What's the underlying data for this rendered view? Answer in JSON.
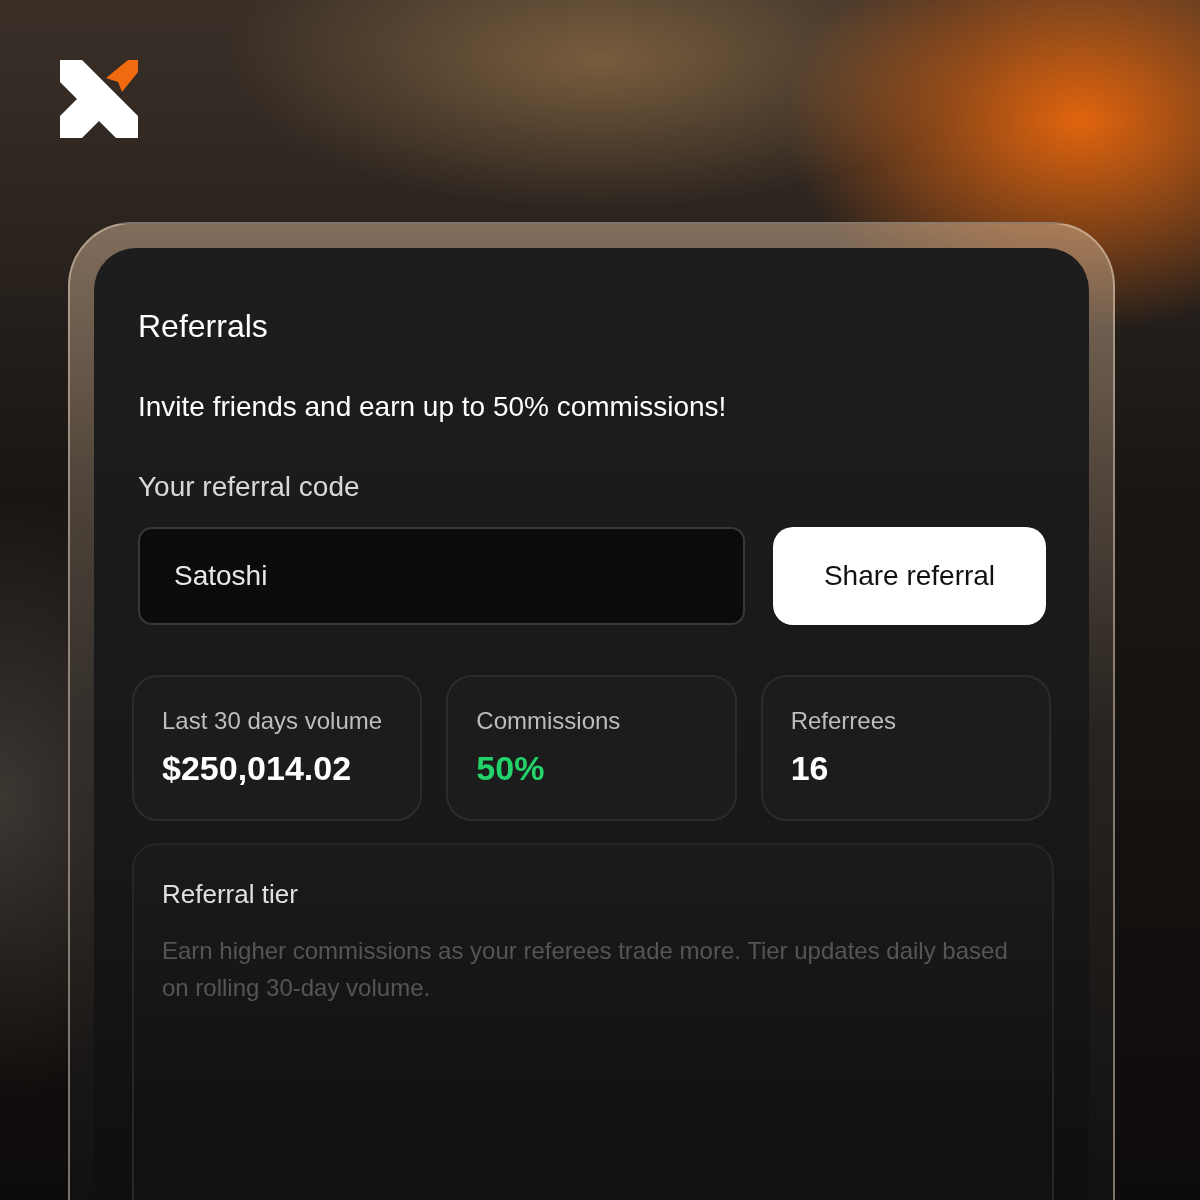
{
  "panel": {
    "title": "Referrals",
    "tagline": "Invite friends and earn up to 50% commissions!",
    "code_label": "Your referral code",
    "code_field": {
      "value": "Satoshi"
    },
    "share_button": "Share referral"
  },
  "stats": [
    {
      "label": "Last 30 days volume",
      "value": "$250,014.02",
      "kind": "plain"
    },
    {
      "label": "Commissions",
      "value": "50%",
      "kind": "positive"
    },
    {
      "label": "Referrees",
      "value": "16",
      "kind": "plain"
    }
  ],
  "tier": {
    "title": "Referral tier",
    "description": "Earn higher commissions as your referees trade more. Tier updates daily based on rolling 30-day volume."
  }
}
